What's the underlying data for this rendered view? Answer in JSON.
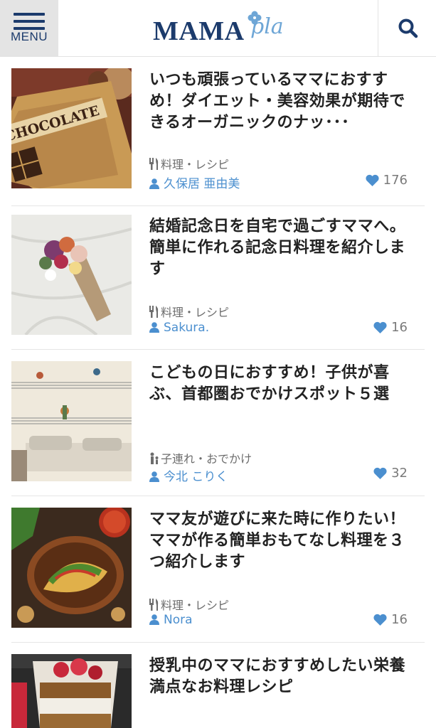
{
  "header": {
    "menu_label": "MENU",
    "logo_main": "MAMA",
    "logo_sub": "pla",
    "colors": {
      "navy": "#1c3b6c",
      "accent": "#4b8fcf",
      "menu_bg": "#e4e4e4"
    }
  },
  "articles": [
    {
      "title": "いつも頑張っているママにおすすめ！ダイエット・美容効果が期待できるオーガニックのナッ･･･",
      "category": "料理・レシピ",
      "category_icon": "fork-knife-icon",
      "author": "久保居 亜由美",
      "likes": "176",
      "thumb_text": "CHOCOLATE"
    },
    {
      "title": "結婚記念日を自宅で過ごすママへ。簡単に作れる記念日料理を紹介します",
      "category": "料理・レシピ",
      "category_icon": "fork-knife-icon",
      "author": "Sakura.",
      "likes": "16"
    },
    {
      "title": "こどもの日におすすめ！子供が喜ぶ、首都圏おでかけスポット５選",
      "category": "子連れ・おでかけ",
      "category_icon": "parent-child-icon",
      "author": "今北 こりく",
      "likes": "32"
    },
    {
      "title": "ママ友が遊びに来た時に作りたい！ママが作る簡単おもてなし料理を３つ紹介します",
      "category": "料理・レシピ",
      "category_icon": "fork-knife-icon",
      "author": "Nora",
      "likes": "16"
    },
    {
      "title": "授乳中のママにおすすめしたい栄養満点なお料理レシピ"
    }
  ]
}
